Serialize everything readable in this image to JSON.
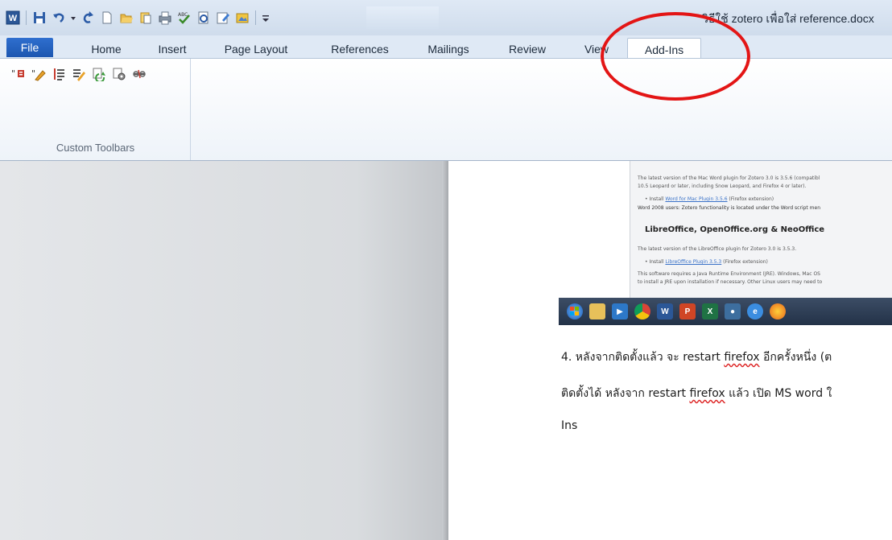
{
  "window": {
    "title": "วิธีใช้ zotero เพื่อใส่ reference.docx"
  },
  "quick_access": {
    "icons": [
      "word-app-icon",
      "save-icon",
      "undo-icon",
      "redo-icon",
      "new-document-icon",
      "open-folder-icon",
      "open-icon",
      "print-icon",
      "spelling-icon",
      "print-preview-icon",
      "edit-icon",
      "image-icon",
      "customize-toolbar-icon"
    ]
  },
  "tabs": [
    "File",
    "Home",
    "Insert",
    "Page Layout",
    "References",
    "Mailings",
    "Review",
    "View",
    "Add-Ins"
  ],
  "active_tab": "Add-Ins",
  "ribbon": {
    "group_label": "Custom Toolbars",
    "icons": [
      "zotero-insert-citation-icon",
      "zotero-edit-citation-icon",
      "zotero-insert-bibliography-icon",
      "zotero-edit-bibliography-icon",
      "zotero-refresh-icon",
      "zotero-preferences-icon",
      "zotero-unlink-icon"
    ]
  },
  "embedded_screenshot": {
    "line1": "The latest version of the Mac Word plugin for Zotero 3.0 is 3.5.6 (compatibl",
    "line2": "10.5 Leopard or later, including Snow Leopard, and Firefox 4 or later).",
    "line3_prefix": "• Install ",
    "line3_link": "Word for Mac Plugin 3.5.6",
    "line3_suffix": " (Firefox extension)",
    "line4": "Word 2008 users: Zotero functionality is located under the Word script men",
    "heading": "LibreOffice, OpenOffice.org & NeoOffice",
    "line5": "The latest version of the LibreOffice plugin for Zotero 3.0 is 3.5.3.",
    "line6_prefix": "• Install ",
    "line6_link": "LibreOffice Plugin 3.5.3",
    "line6_suffix": " (Firefox extension)",
    "line7": "This software requires a Java Runtime Environment (JRE). Windows, Mac OS",
    "line8": "to install a JRE upon installation if necessary. Other Linux users may need to"
  },
  "taskbar_icons": [
    "windows-start-icon",
    "folder-icon",
    "media-player-icon",
    "chrome-icon",
    "word-icon",
    "powerpoint-icon",
    "excel-icon",
    "network-icon",
    "internet-explorer-icon",
    "firefox-icon"
  ],
  "document": {
    "para1_a": "4. หลังจากติดตั้งแล้ว จะ restart ",
    "para1_b": "firefox",
    "para1_c": " อีกครั้งหนึ่ง (ต",
    "para2_a": "ติดตั้งได้  หลังจาก restart ",
    "para2_b": "firefox",
    "para2_c": " แล้ว เปิด MS word ใ",
    "para3": "Ins"
  },
  "colors": {
    "annotation_circle": "#e31515",
    "file_tab": "#2a64c0"
  }
}
